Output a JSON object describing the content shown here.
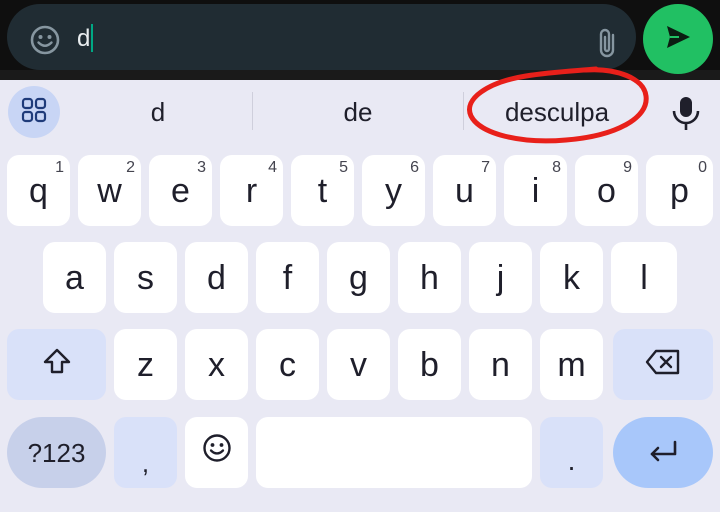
{
  "compose": {
    "text": "d"
  },
  "suggestions": {
    "items": [
      "d",
      "de",
      "desculpa"
    ]
  },
  "keyboard": {
    "row1": [
      {
        "key": "q",
        "hint": "1"
      },
      {
        "key": "w",
        "hint": "2"
      },
      {
        "key": "e",
        "hint": "3"
      },
      {
        "key": "r",
        "hint": "4"
      },
      {
        "key": "t",
        "hint": "5"
      },
      {
        "key": "y",
        "hint": "6"
      },
      {
        "key": "u",
        "hint": "7"
      },
      {
        "key": "i",
        "hint": "8"
      },
      {
        "key": "o",
        "hint": "9"
      },
      {
        "key": "p",
        "hint": "0"
      }
    ],
    "row2": [
      "a",
      "s",
      "d",
      "f",
      "g",
      "h",
      "j",
      "k",
      "l"
    ],
    "row3": [
      "z",
      "x",
      "c",
      "v",
      "b",
      "n",
      "m"
    ],
    "symbols_label": "?123",
    "comma": ",",
    "period": "."
  },
  "icons": {
    "emoji": "emoji-icon",
    "attach": "paperclip-icon",
    "send": "send-icon",
    "apps": "grid-icon",
    "mic": "microphone-icon",
    "shift": "shift-icon",
    "backspace": "backspace-icon",
    "enter": "enter-icon",
    "emoji_key": "emoji-key-icon"
  },
  "colors": {
    "send_button": "#21c063",
    "caret": "#00a884",
    "annotation": "#e8201a",
    "enter_key": "#a8c7fa"
  }
}
